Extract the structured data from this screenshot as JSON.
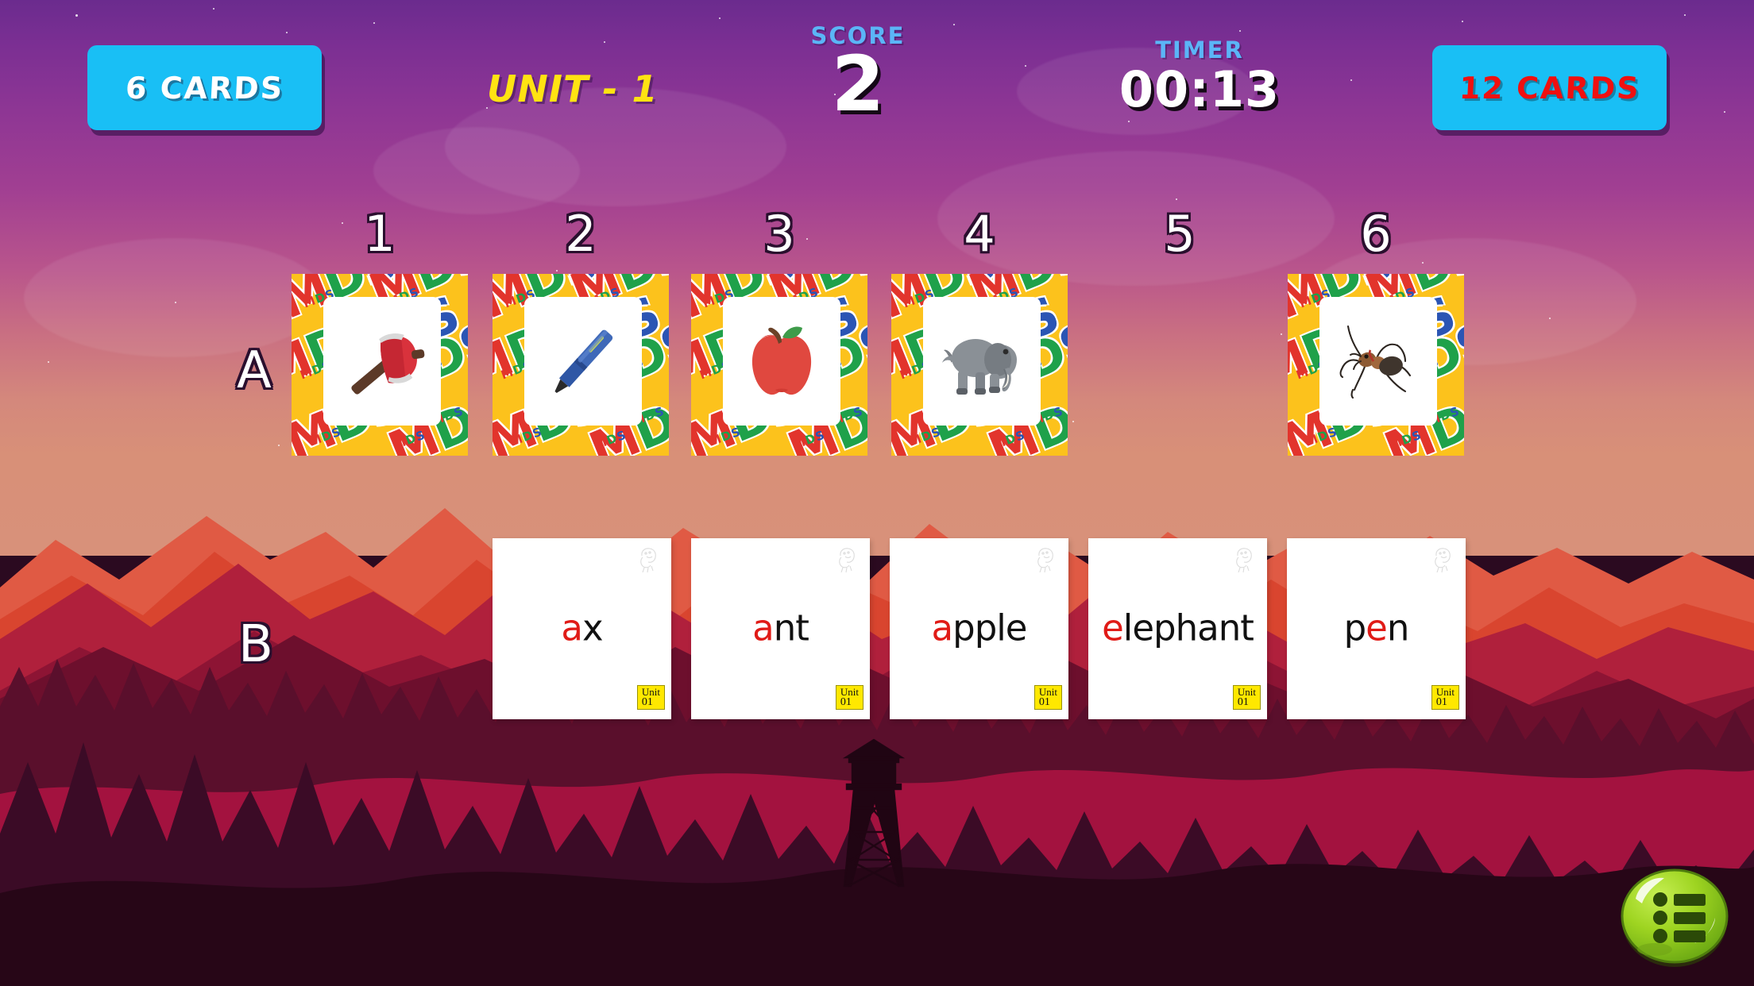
{
  "hud": {
    "left_button_label": "6 CARDS",
    "right_button_label": "12 CARDS",
    "unit_label": "UNIT - 1",
    "score_caption": "SCORE",
    "score_value": "2",
    "timer_caption": "TIMER",
    "timer_value": "00:13"
  },
  "grid": {
    "column_numbers": [
      "1",
      "2",
      "3",
      "4",
      "5",
      "6"
    ],
    "row_labels": {
      "a": "A",
      "b": "B"
    }
  },
  "picture_cards": [
    {
      "column": "1",
      "icon": "axe-icon",
      "present": true
    },
    {
      "column": "2",
      "icon": "pen-icon",
      "present": true
    },
    {
      "column": "3",
      "icon": "apple-icon",
      "present": true
    },
    {
      "column": "4",
      "icon": "elephant-icon",
      "present": true
    },
    {
      "column": "5",
      "icon": "",
      "present": false
    },
    {
      "column": "6",
      "icon": "ant-icon",
      "present": true
    }
  ],
  "card_back_pattern_text": "MDS",
  "word_cards": [
    {
      "word": "ax",
      "highlight_index": 0,
      "unit_caption": "Unit",
      "unit_number": "01"
    },
    {
      "word": "ant",
      "highlight_index": 0,
      "unit_caption": "Unit",
      "unit_number": "01"
    },
    {
      "word": "apple",
      "highlight_index": 0,
      "unit_caption": "Unit",
      "unit_number": "01"
    },
    {
      "word": "elephant",
      "highlight_index": 0,
      "unit_caption": "Unit",
      "unit_number": "01"
    },
    {
      "word": "pen",
      "highlight_index": 1,
      "unit_caption": "Unit",
      "unit_number": "01"
    }
  ],
  "menu": {
    "icon": "list-menu-icon"
  },
  "colors": {
    "button_fill": "#19bff5",
    "left_button_text": "#ffffff",
    "right_button_text": "#f01010",
    "unit_text": "#ffe312",
    "stat_caption": "#5bb5f7",
    "stat_value": "#ffffff",
    "card_back": "#fcc21c",
    "word_highlight": "#e01b17",
    "unit_badge": "#ffe800",
    "menu_button": "#8cc61e"
  }
}
